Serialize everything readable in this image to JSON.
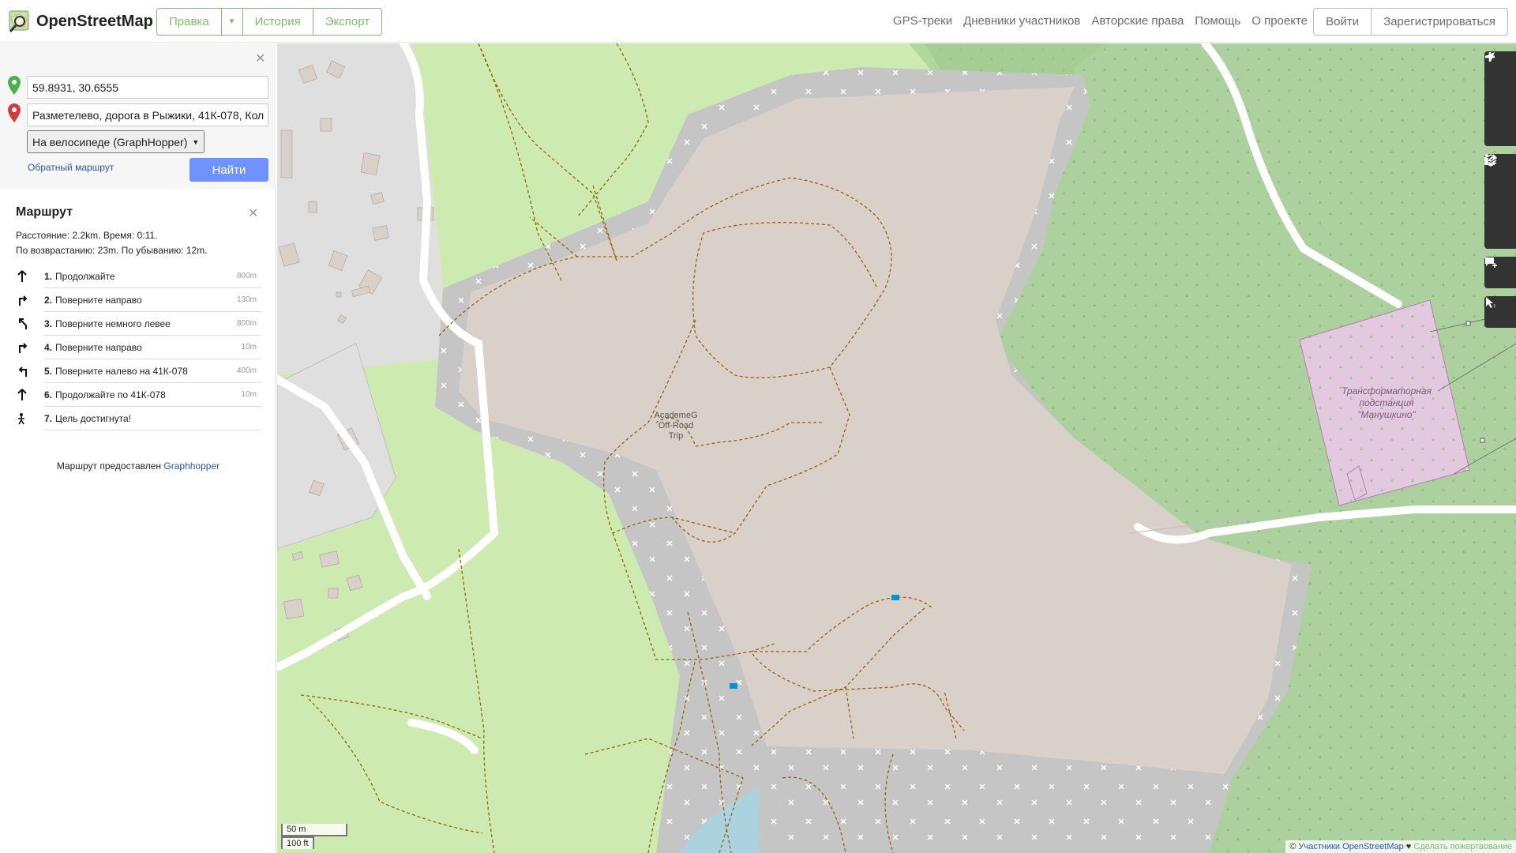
{
  "header": {
    "logo_text": "OpenStreetMap",
    "edit_label": "Правка",
    "history_label": "История",
    "export_label": "Экспорт",
    "nav": [
      "GPS-треки",
      "Дневники участников",
      "Авторские права",
      "Помощь",
      "О проекте"
    ],
    "login_label": "Войти",
    "signup_label": "Зарегистрироваться"
  },
  "directions": {
    "from": "59.8931, 30.6555",
    "to": "Разметелево, дорога в Рыжики, 41К-078, Кол",
    "engine": "На велосипеде (GraphHopper)",
    "reverse_label": "Обратный маршрут",
    "find_label": "Найти"
  },
  "route": {
    "title": "Маршрут",
    "summary1": "Расстояние: 2.2km. Время: 0:11.",
    "summary2": "По возврастанию: 23m. По убыванию: 12m.",
    "steps": [
      {
        "num": "1.",
        "text": "Продолжайте",
        "dist": "800m",
        "icon": "straight-arrow-icon"
      },
      {
        "num": "2.",
        "text": "Поверните направо",
        "dist": "130m",
        "icon": "turn-right-icon"
      },
      {
        "num": "3.",
        "text": "Поверните немного левее",
        "dist": "800m",
        "icon": "slight-left-icon"
      },
      {
        "num": "4.",
        "text": "Поверните направо",
        "dist": "10m",
        "icon": "turn-right-icon"
      },
      {
        "num": "5.",
        "text": "Поверните налево на 41К-078",
        "dist": "400m",
        "icon": "turn-left-icon"
      },
      {
        "num": "6.",
        "text": "Продолжайте по 41К-078",
        "dist": "10m",
        "icon": "straight-arrow-icon"
      },
      {
        "num": "7.",
        "text": "Цель достигнута!",
        "dist": "",
        "icon": "destination-icon"
      }
    ],
    "credit_text": "Маршрут предоставлен ",
    "credit_link": "Graphhopper"
  },
  "map": {
    "poi_label_1": "AcademeG",
    "poi_label_2": "Off-Road",
    "poi_label_3": "Trip",
    "substation_1": "Трансформаторная",
    "substation_2": "подстанция",
    "substation_3": "\"Манушкино\"",
    "scale_m": "50 m",
    "scale_ft": "100 ft",
    "attribution_prefix": "© ",
    "attribution_link": "Участники OpenStreetMap",
    "attribution_heart": " ♥ ",
    "attribution_donate": "Сделать пожертвование"
  },
  "colors": {
    "brand_green": "#7ebc6f",
    "find_button": "#7092ff",
    "quarry": "#d9d0c9",
    "grass": "#cdebb0",
    "forest": "#add19e",
    "residential": "#e0dfdf"
  }
}
